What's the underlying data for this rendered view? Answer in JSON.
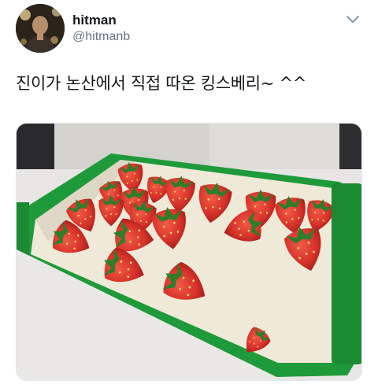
{
  "user": {
    "display_name": "hitman",
    "handle": "@hitmanb",
    "avatar_icon": "avatar-photo"
  },
  "tweet": {
    "text": "진이가 논산에서 직접 따온 킹스베리~ ^^",
    "more_icon": "chevron-down-icon"
  },
  "media": {
    "subject": "strawberries-on-tray",
    "tray_color": "#1f9a3a",
    "berry_color": "#d6322a"
  }
}
